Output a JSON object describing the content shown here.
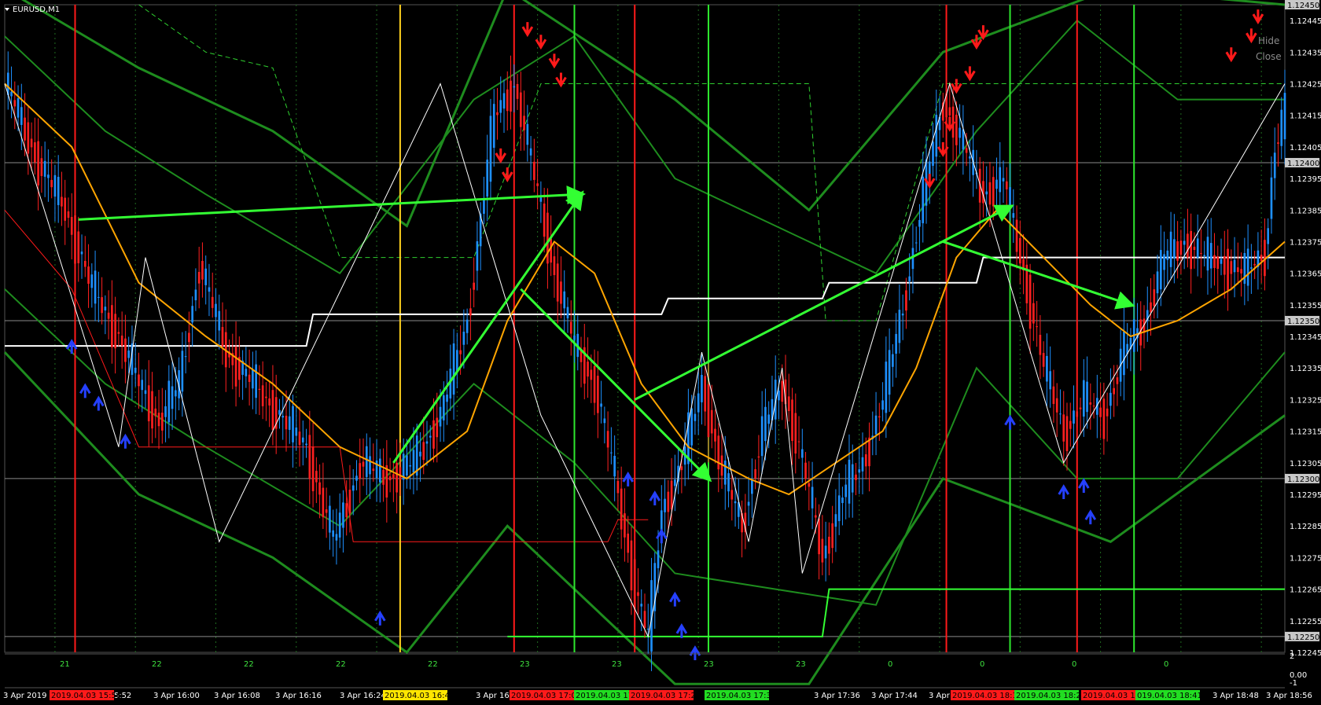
{
  "window": {
    "title": "EURUSD,M1"
  },
  "buttons": {
    "hide": "Hide",
    "close": "Close"
  },
  "colors": {
    "bull": "#1e90ff",
    "bear": "#ff2020",
    "ma": "#ffa500",
    "band": "#1e8c1e",
    "arrow": "#33ff33",
    "grid": "#1f6a1f"
  },
  "price_labels": [
    {
      "text": "1.12400",
      "highlight": true
    },
    {
      "text": "1.12350",
      "highlight": true
    },
    {
      "text": "1.12300",
      "highlight": true
    },
    {
      "text": "1.12250",
      "highlight": true
    },
    {
      "text": "1.12450",
      "highlight": true
    }
  ],
  "time_labels": [
    "3 Apr 2019",
    "Apr 15:52",
    "3 Apr 16:00",
    "3 Apr 16:08",
    "3 Apr 16:16",
    "3 Apr 16:24",
    "3 Apr 1",
    "3 Apr 16:48",
    "20",
    "3 Apr 17:36",
    "3 Apr 17:44",
    "3 Apr 17:52",
    "3 Apr 18:00",
    "3 Apr 18:48",
    "3 Apr 18:56"
  ],
  "time_markers": [
    {
      "text": "2019.04.03 15:56",
      "color": "red"
    },
    {
      "text": "2019.04.03 16:41",
      "color": "yellow"
    },
    {
      "text": "2019.04.03 17:01",
      "color": "red"
    },
    {
      "text": "2019.04.03 17:1",
      "color": "green"
    },
    {
      "text": "2019.04.03 17:20",
      "color": "red"
    },
    {
      "text": "2019.04.03 17:32",
      "color": "green"
    },
    {
      "text": "2019.04.03 18:11",
      "color": "red"
    },
    {
      "text": "2019.04.03 18:21",
      "color": "green"
    },
    {
      "text": "2019.04.03 18:32",
      "color": "red"
    },
    {
      "text": "019.04.03 18:41",
      "color": "green"
    }
  ],
  "counters": [
    "21",
    "22",
    "22",
    "22",
    "22",
    "23",
    "23",
    "23",
    "23",
    "0",
    "0",
    "0",
    "0"
  ],
  "sub_axis": [
    "2",
    "0.00",
    "-1"
  ],
  "chart_data": {
    "type": "candlestick",
    "symbol": "EURUSD",
    "timeframe": "M1",
    "ylim": [
      1.12245,
      1.1245
    ],
    "y_ticks": [
      1.12445,
      1.12435,
      1.12425,
      1.12415,
      1.12405,
      1.12395,
      1.12385,
      1.12375,
      1.12365,
      1.12355,
      1.12345,
      1.12335,
      1.12325,
      1.12315,
      1.12305,
      1.12295,
      1.12285,
      1.12275,
      1.12265,
      1.12255,
      1.12245
    ],
    "horizontal_levels": [
      1.124,
      1.1235,
      1.123,
      1.1225
    ],
    "close_path": [
      [
        0,
        1.12425
      ],
      [
        10,
        1.124
      ],
      [
        18,
        1.12385
      ],
      [
        26,
        1.1236
      ],
      [
        34,
        1.12345
      ],
      [
        40,
        1.1233
      ],
      [
        46,
        1.12318
      ],
      [
        52,
        1.1233
      ],
      [
        58,
        1.12368
      ],
      [
        66,
        1.1234
      ],
      [
        78,
        1.12325
      ],
      [
        90,
        1.1231
      ],
      [
        98,
        1.1228
      ],
      [
        106,
        1.12305
      ],
      [
        114,
        1.123
      ],
      [
        122,
        1.12305
      ],
      [
        130,
        1.1232
      ],
      [
        138,
        1.1235
      ],
      [
        146,
        1.12415
      ],
      [
        152,
        1.12425
      ],
      [
        158,
        1.12395
      ],
      [
        164,
        1.12365
      ],
      [
        170,
        1.12342
      ],
      [
        176,
        1.1233
      ],
      [
        182,
        1.123
      ],
      [
        188,
        1.12265
      ],
      [
        192,
        1.1225
      ],
      [
        196,
        1.1229
      ],
      [
        202,
        1.12305
      ],
      [
        208,
        1.1233
      ],
      [
        214,
        1.12302
      ],
      [
        220,
        1.12285
      ],
      [
        226,
        1.12315
      ],
      [
        232,
        1.1233
      ],
      [
        238,
        1.12305
      ],
      [
        244,
        1.12275
      ],
      [
        250,
        1.12295
      ],
      [
        256,
        1.12305
      ],
      [
        262,
        1.12325
      ],
      [
        268,
        1.12355
      ],
      [
        274,
        1.1239
      ],
      [
        280,
        1.1242
      ],
      [
        286,
        1.12405
      ],
      [
        292,
        1.1239
      ],
      [
        298,
        1.12395
      ],
      [
        304,
        1.12365
      ],
      [
        310,
        1.12335
      ],
      [
        316,
        1.12315
      ],
      [
        322,
        1.12325
      ],
      [
        328,
        1.1232
      ],
      [
        334,
        1.1234
      ],
      [
        340,
        1.1235
      ],
      [
        346,
        1.1237
      ],
      [
        352,
        1.12375
      ],
      [
        358,
        1.1237
      ],
      [
        364,
        1.12368
      ],
      [
        370,
        1.12365
      ],
      [
        376,
        1.12372
      ],
      [
        379,
        1.12405
      ],
      [
        382,
        1.12415
      ]
    ],
    "zigzag": [
      [
        0,
        1.12425
      ],
      [
        34,
        1.1231
      ],
      [
        42,
        1.1237
      ],
      [
        64,
        1.1228
      ],
      [
        130,
        1.12425
      ],
      [
        160,
        1.1232
      ],
      [
        192,
        1.1225
      ],
      [
        208,
        1.1234
      ],
      [
        222,
        1.1228
      ],
      [
        232,
        1.12335
      ],
      [
        238,
        1.1227
      ],
      [
        282,
        1.12425
      ],
      [
        316,
        1.12305
      ],
      [
        382,
        1.12425
      ]
    ],
    "ma": [
      [
        0,
        1.12425
      ],
      [
        20,
        1.12405
      ],
      [
        40,
        1.12362
      ],
      [
        60,
        1.12345
      ],
      [
        80,
        1.1233
      ],
      [
        100,
        1.1231
      ],
      [
        120,
        1.123
      ],
      [
        138,
        1.12315
      ],
      [
        150,
        1.1235
      ],
      [
        164,
        1.12375
      ],
      [
        176,
        1.12365
      ],
      [
        190,
        1.1233
      ],
      [
        204,
        1.1231
      ],
      [
        222,
        1.123
      ],
      [
        234,
        1.12295
      ],
      [
        248,
        1.12305
      ],
      [
        262,
        1.12315
      ],
      [
        272,
        1.12335
      ],
      [
        284,
        1.1237
      ],
      [
        296,
        1.12385
      ],
      [
        310,
        1.1237
      ],
      [
        324,
        1.12355
      ],
      [
        336,
        1.12345
      ],
      [
        350,
        1.1235
      ],
      [
        366,
        1.1236
      ],
      [
        382,
        1.12375
      ]
    ],
    "bands": [
      [
        [
          0,
          1.1244
        ],
        [
          30,
          1.1241
        ],
        [
          60,
          1.1239
        ],
        [
          100,
          1.12365
        ],
        [
          140,
          1.1242
        ],
        [
          170,
          1.1244
        ],
        [
          200,
          1.12395
        ],
        [
          230,
          1.1238
        ],
        [
          260,
          1.12365
        ],
        [
          290,
          1.1241
        ],
        [
          320,
          1.12445
        ],
        [
          350,
          1.1242
        ],
        [
          382,
          1.1242
        ]
      ],
      [
        [
          0,
          1.1236
        ],
        [
          30,
          1.1233
        ],
        [
          60,
          1.1231
        ],
        [
          100,
          1.12285
        ],
        [
          140,
          1.1233
        ],
        [
          170,
          1.12305
        ],
        [
          200,
          1.1227
        ],
        [
          230,
          1.12265
        ],
        [
          260,
          1.1226
        ],
        [
          290,
          1.12335
        ],
        [
          320,
          1.123
        ],
        [
          350,
          1.123
        ],
        [
          382,
          1.1234
        ]
      ],
      [
        [
          0,
          1.12455
        ],
        [
          40,
          1.1243
        ],
        [
          80,
          1.1241
        ],
        [
          120,
          1.1238
        ],
        [
          150,
          1.12455
        ],
        [
          200,
          1.1242
        ],
        [
          240,
          1.12385
        ],
        [
          280,
          1.12435
        ],
        [
          330,
          1.12455
        ],
        [
          382,
          1.1245
        ]
      ],
      [
        [
          0,
          1.1234
        ],
        [
          40,
          1.12295
        ],
        [
          80,
          1.12275
        ],
        [
          120,
          1.12245
        ],
        [
          150,
          1.12285
        ],
        [
          200,
          1.12235
        ],
        [
          240,
          1.12235
        ],
        [
          280,
          1.123
        ],
        [
          330,
          1.1228
        ],
        [
          382,
          1.1232
        ]
      ]
    ],
    "white_level": [
      [
        0,
        1.12342
      ],
      [
        90,
        1.12342
      ],
      [
        92,
        1.12352
      ],
      [
        196,
        1.12352
      ],
      [
        198,
        1.12357
      ],
      [
        244,
        1.12357
      ],
      [
        246,
        1.12362
      ],
      [
        290,
        1.12362
      ],
      [
        292,
        1.1237
      ],
      [
        382,
        1.1237
      ]
    ],
    "green_level": [
      [
        150,
        1.1225
      ],
      [
        244,
        1.1225
      ],
      [
        246,
        1.12265
      ],
      [
        382,
        1.12265
      ]
    ],
    "red_step": [
      [
        0,
        1.12385
      ],
      [
        20,
        1.1236
      ],
      [
        40,
        1.1231
      ],
      [
        100,
        1.1231
      ],
      [
        104,
        1.1228
      ],
      [
        180,
        1.1228
      ],
      [
        183,
        1.12287
      ],
      [
        192,
        1.12287
      ]
    ],
    "dashed_green": [
      [
        40,
        1.1245
      ],
      [
        60,
        1.12435
      ],
      [
        80,
        1.1243
      ],
      [
        90,
        1.124
      ],
      [
        100,
        1.1237
      ],
      [
        140,
        1.1237
      ],
      [
        160,
        1.12425
      ],
      [
        240,
        1.12425
      ],
      [
        245,
        1.1235
      ],
      [
        260,
        1.1235
      ],
      [
        280,
        1.12425
      ],
      [
        340,
        1.12425
      ],
      [
        382,
        1.12425
      ]
    ],
    "trend_arrows": [
      [
        [
          22,
          1.12382
        ],
        [
          172,
          1.1239
        ]
      ],
      [
        [
          116,
          1.12305
        ],
        [
          172,
          1.1239
        ]
      ],
      [
        [
          154,
          1.1236
        ],
        [
          210,
          1.123
        ]
      ],
      [
        [
          188,
          1.12325
        ],
        [
          300,
          1.12386
        ]
      ],
      [
        [
          280,
          1.12375
        ],
        [
          336,
          1.12355
        ]
      ]
    ],
    "down_signals": [
      [
        148,
        1.12402
      ],
      [
        156,
        1.12442
      ],
      [
        160,
        1.12438
      ],
      [
        164,
        1.12432
      ],
      [
        166,
        1.12426
      ],
      [
        150,
        1.12396
      ],
      [
        276,
        1.12394
      ],
      [
        280,
        1.12404
      ],
      [
        282,
        1.12412
      ],
      [
        284,
        1.12424
      ],
      [
        288,
        1.12428
      ],
      [
        290,
        1.12438
      ],
      [
        292,
        1.12441
      ],
      [
        366,
        1.12434
      ],
      [
        372,
        1.1244
      ],
      [
        374,
        1.12446
      ]
    ],
    "up_signals": [
      [
        20,
        1.12342
      ],
      [
        24,
        1.12328
      ],
      [
        28,
        1.12324
      ],
      [
        36,
        1.12312
      ],
      [
        186,
        1.123
      ],
      [
        194,
        1.12294
      ],
      [
        196,
        1.12282
      ],
      [
        200,
        1.12262
      ],
      [
        202,
        1.12252
      ],
      [
        206,
        1.12245
      ],
      [
        112,
        1.12256
      ],
      [
        316,
        1.12296
      ],
      [
        322,
        1.12298
      ],
      [
        324,
        1.12288
      ],
      [
        300,
        1.12318
      ]
    ],
    "vlines": [
      {
        "i": 21,
        "color": "red"
      },
      {
        "i": 118,
        "color": "yellow"
      },
      {
        "i": 152,
        "color": "red"
      },
      {
        "i": 170,
        "color": "green"
      },
      {
        "i": 188,
        "color": "red"
      },
      {
        "i": 210,
        "color": "green"
      },
      {
        "i": 281,
        "color": "red"
      },
      {
        "i": 300,
        "color": "green"
      },
      {
        "i": 320,
        "color": "red"
      },
      {
        "i": 337,
        "color": "green"
      }
    ]
  }
}
